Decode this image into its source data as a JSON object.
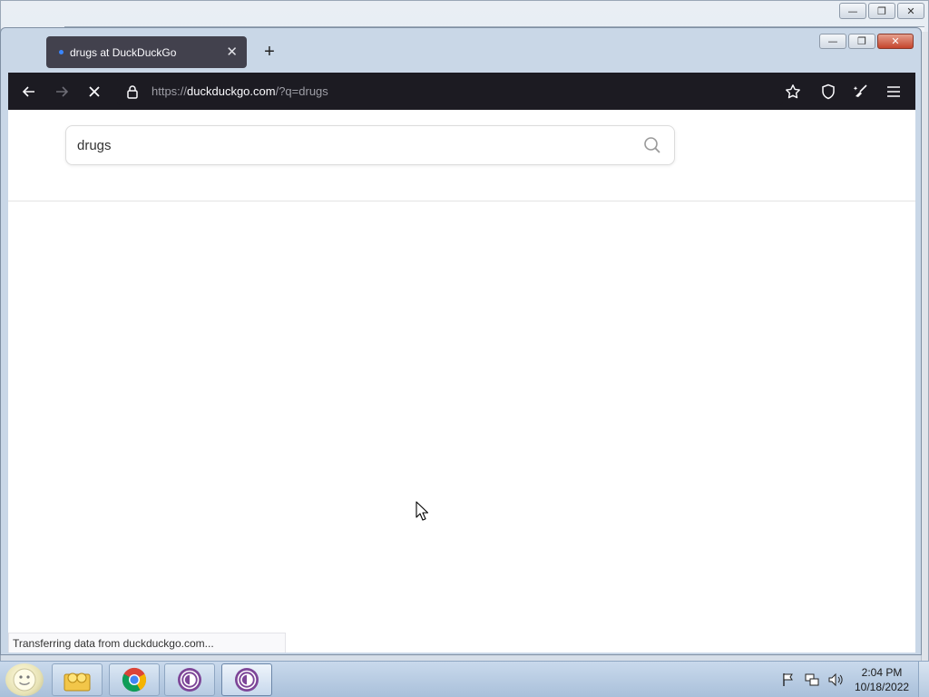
{
  "browser": {
    "tab": {
      "title": "drugs at DuckDuckGo",
      "close_glyph": "✕"
    },
    "new_tab_glyph": "+",
    "url": {
      "scheme": "https://",
      "host": "duckduckgo.com",
      "path": "/?q=drugs"
    },
    "status_text": "Transferring data from duckduckgo.com..."
  },
  "page": {
    "search": {
      "value": "drugs"
    }
  },
  "window_controls": {
    "minimize": "—",
    "maximize": "❐",
    "close": "✕"
  },
  "taskbar": {
    "clock": {
      "time": "2:04 PM",
      "date": "10/18/2022"
    },
    "items": [
      "start-orb",
      "file-explorer",
      "chrome",
      "tor-browser",
      "tor-browser"
    ]
  },
  "colors": {
    "toolbar": "#1c1b22",
    "tab_active": "#42414d",
    "tor_purple": "#7d4698",
    "chrome_red": "#db4437",
    "chrome_yellow": "#f4b400",
    "chrome_green": "#0f9d58",
    "chrome_blue": "#4285f4"
  }
}
